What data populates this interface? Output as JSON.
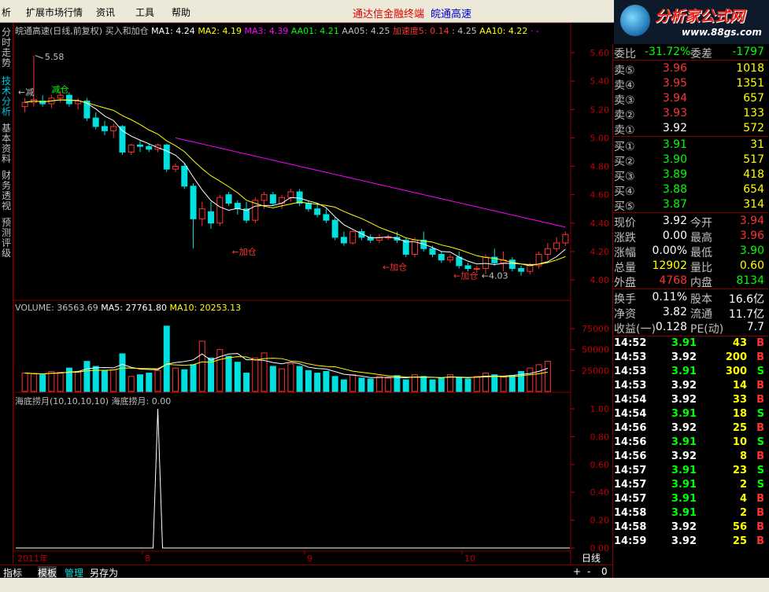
{
  "menu": {
    "items": [
      "析",
      "扩展市场行情",
      "资讯",
      "工具",
      "帮助"
    ],
    "brand_red": "通达信金融终端",
    "brand_blue": "皖通高速"
  },
  "logo": {
    "title": "分析家公式网",
    "url": "www.88gs.com"
  },
  "left_tabs": [
    "分时走势",
    "技术分析",
    "基本资料",
    "财务透视",
    "预测评级"
  ],
  "chart_header": {
    "title": "皖通高速(日线,前复权)",
    "formula": "买入和加仓",
    "ma1": "MA1: 4.24",
    "ma2": "MA2: 4.19",
    "ma3": "MA3: 4.39",
    "aa01": "AA01: 4.21",
    "aa05": "AA05: 4.25",
    "jsd": "加速度5: 0.14",
    "jsd2": ": 4.25",
    "aa10": "AA10: 4.22",
    "tail": "·  -"
  },
  "price_axis": [
    "5.60",
    "5.40",
    "5.20",
    "5.00",
    "4.80",
    "4.60",
    "4.40",
    "4.20",
    "4.00"
  ],
  "annotations": {
    "high": "5.58",
    "low": "4.03",
    "jc": "减仓",
    "add": [
      "←加仓",
      "←加仓",
      "←加仓"
    ],
    "jc2": "←减"
  },
  "volume_header": {
    "v": "VOLUME: 36563.69",
    "ma5": "MA5: 27761.80",
    "ma10": "MA10: 20253.13"
  },
  "volume_axis": [
    "75000",
    "50000",
    "25000"
  ],
  "ind_header": {
    "name": "海底捞月(10,10,10,10)",
    "val": "海底捞月: 0.00"
  },
  "ind_axis": [
    "1.00",
    "0.80",
    "0.60",
    "0.40",
    "0.20",
    "0.00"
  ],
  "time_axis": {
    "year": "2011年",
    "m8": "8",
    "m9": "9",
    "m10": "10",
    "period": "日线"
  },
  "bottom_tabs": [
    "指标",
    "模板",
    "管理",
    "另存为"
  ],
  "bottom_right": [
    "+",
    "-",
    "0"
  ],
  "quote": {
    "wb_label": "委比",
    "wb": "-31.72%",
    "wc_label": "委差",
    "wc": "-1797",
    "sell": [
      {
        "l": "卖⑤",
        "p": "3.96",
        "v": "1018"
      },
      {
        "l": "卖④",
        "p": "3.95",
        "v": "1351"
      },
      {
        "l": "卖③",
        "p": "3.94",
        "v": "657"
      },
      {
        "l": "卖②",
        "p": "3.93",
        "v": "133"
      },
      {
        "l": "卖①",
        "p": "3.92",
        "v": "572"
      }
    ],
    "buy": [
      {
        "l": "买①",
        "p": "3.91",
        "v": "31"
      },
      {
        "l": "买②",
        "p": "3.90",
        "v": "517"
      },
      {
        "l": "买③",
        "p": "3.89",
        "v": "418"
      },
      {
        "l": "买④",
        "p": "3.88",
        "v": "654"
      },
      {
        "l": "买⑤",
        "p": "3.87",
        "v": "314"
      }
    ],
    "stats": [
      {
        "a": "现价",
        "av": "3.92",
        "b": "今开",
        "bv": "3.94"
      },
      {
        "a": "涨跌",
        "av": "0.00",
        "b": "最高",
        "bv": "3.96"
      },
      {
        "a": "涨幅",
        "av": "0.00%",
        "b": "最低",
        "bv": "3.90"
      },
      {
        "a": "总量",
        "av": "12902",
        "b": "量比",
        "bv": "0.60"
      },
      {
        "a": "外盘",
        "av": "4768",
        "b": "内盘",
        "bv": "8134"
      }
    ],
    "stats2": [
      {
        "a": "换手",
        "av": "0.11%",
        "b": "股本",
        "bv": "16.6亿"
      },
      {
        "a": "净资",
        "av": "3.82",
        "b": "流通",
        "bv": "11.7亿"
      },
      {
        "a": "收益(一)",
        "av": "0.128",
        "b": "PE(动)",
        "bv": "7.7"
      }
    ],
    "ticks": [
      {
        "t": "14:52",
        "p": "3.91",
        "v": "43",
        "s": "B"
      },
      {
        "t": "14:53",
        "p": "3.92",
        "v": "200",
        "s": "B"
      },
      {
        "t": "14:53",
        "p": "3.91",
        "v": "300",
        "s": "S"
      },
      {
        "t": "14:53",
        "p": "3.92",
        "v": "14",
        "s": "B"
      },
      {
        "t": "14:54",
        "p": "3.92",
        "v": "33",
        "s": "B"
      },
      {
        "t": "14:54",
        "p": "3.91",
        "v": "18",
        "s": "S"
      },
      {
        "t": "14:56",
        "p": "3.92",
        "v": "25",
        "s": "B"
      },
      {
        "t": "14:56",
        "p": "3.91",
        "v": "10",
        "s": "S"
      },
      {
        "t": "14:56",
        "p": "3.92",
        "v": "8",
        "s": "B"
      },
      {
        "t": "14:57",
        "p": "3.91",
        "v": "23",
        "s": "S"
      },
      {
        "t": "14:57",
        "p": "3.91",
        "v": "2",
        "s": "S"
      },
      {
        "t": "14:57",
        "p": "3.91",
        "v": "4",
        "s": "B"
      },
      {
        "t": "14:58",
        "p": "3.91",
        "v": "2",
        "s": "B"
      },
      {
        "t": "14:58",
        "p": "3.92",
        "v": "56",
        "s": "B"
      },
      {
        "t": "14:59",
        "p": "3.92",
        "v": "25",
        "s": "B"
      }
    ]
  },
  "colors": {
    "up": "#ff3232",
    "down": "#00e0e0",
    "ma1": "#ffffff",
    "ma2": "#ffff00",
    "ma3": "#ff00ff",
    "aa": "#00ff00",
    "grid": "#800000",
    "axis_red": "#c00000"
  },
  "chart_data": {
    "type": "candlestick",
    "ylim_price": [
      4.0,
      5.6
    ],
    "candles": [
      {
        "o": 5.22,
        "h": 5.28,
        "l": 5.18,
        "c": 5.25
      },
      {
        "o": 5.25,
        "h": 5.58,
        "l": 5.22,
        "c": 5.27
      },
      {
        "o": 5.26,
        "h": 5.3,
        "l": 5.22,
        "c": 5.24
      },
      {
        "o": 5.24,
        "h": 5.3,
        "l": 5.21,
        "c": 5.28
      },
      {
        "o": 5.28,
        "h": 5.33,
        "l": 5.25,
        "c": 5.3
      },
      {
        "o": 5.3,
        "h": 5.32,
        "l": 5.22,
        "c": 5.24
      },
      {
        "o": 5.24,
        "h": 5.28,
        "l": 5.2,
        "c": 5.26
      },
      {
        "o": 5.26,
        "h": 5.28,
        "l": 5.12,
        "c": 5.14
      },
      {
        "o": 5.14,
        "h": 5.18,
        "l": 5.06,
        "c": 5.08
      },
      {
        "o": 5.08,
        "h": 5.12,
        "l": 5.02,
        "c": 5.05
      },
      {
        "o": 5.05,
        "h": 5.1,
        "l": 5.0,
        "c": 5.08
      },
      {
        "o": 5.08,
        "h": 5.09,
        "l": 4.88,
        "c": 4.9
      },
      {
        "o": 4.9,
        "h": 4.96,
        "l": 4.88,
        "c": 4.95
      },
      {
        "o": 4.95,
        "h": 4.98,
        "l": 4.9,
        "c": 4.94
      },
      {
        "o": 4.94,
        "h": 4.96,
        "l": 4.9,
        "c": 4.92
      },
      {
        "o": 4.92,
        "h": 4.96,
        "l": 4.9,
        "c": 4.95
      },
      {
        "o": 4.95,
        "h": 4.96,
        "l": 4.76,
        "c": 4.78
      },
      {
        "o": 4.78,
        "h": 4.82,
        "l": 4.76,
        "c": 4.8
      },
      {
        "o": 4.8,
        "h": 4.82,
        "l": 4.64,
        "c": 4.66
      },
      {
        "o": 4.66,
        "h": 4.68,
        "l": 4.22,
        "c": 4.43
      },
      {
        "o": 4.43,
        "h": 4.55,
        "l": 4.38,
        "c": 4.5
      },
      {
        "o": 4.48,
        "h": 4.55,
        "l": 4.36,
        "c": 4.4
      },
      {
        "o": 4.4,
        "h": 4.6,
        "l": 4.38,
        "c": 4.58
      },
      {
        "o": 4.6,
        "h": 4.62,
        "l": 4.52,
        "c": 4.54
      },
      {
        "o": 4.54,
        "h": 4.56,
        "l": 4.46,
        "c": 4.5
      },
      {
        "o": 4.5,
        "h": 4.55,
        "l": 4.4,
        "c": 4.42
      },
      {
        "o": 4.42,
        "h": 4.58,
        "l": 4.4,
        "c": 4.56
      },
      {
        "o": 4.56,
        "h": 4.62,
        "l": 4.5,
        "c": 4.6
      },
      {
        "o": 4.6,
        "h": 4.62,
        "l": 4.52,
        "c": 4.54
      },
      {
        "o": 4.54,
        "h": 4.6,
        "l": 4.5,
        "c": 4.58
      },
      {
        "o": 4.58,
        "h": 4.64,
        "l": 4.55,
        "c": 4.62
      },
      {
        "o": 4.62,
        "h": 4.64,
        "l": 4.52,
        "c": 4.54
      },
      {
        "o": 4.54,
        "h": 4.56,
        "l": 4.48,
        "c": 4.5
      },
      {
        "o": 4.5,
        "h": 4.54,
        "l": 4.44,
        "c": 4.46
      },
      {
        "o": 4.46,
        "h": 4.5,
        "l": 4.4,
        "c": 4.42
      },
      {
        "o": 4.42,
        "h": 4.44,
        "l": 4.28,
        "c": 4.3
      },
      {
        "o": 4.3,
        "h": 4.34,
        "l": 4.24,
        "c": 4.26
      },
      {
        "o": 4.26,
        "h": 4.35,
        "l": 4.25,
        "c": 4.34
      },
      {
        "o": 4.34,
        "h": 4.36,
        "l": 4.28,
        "c": 4.3
      },
      {
        "o": 4.3,
        "h": 4.32,
        "l": 4.26,
        "c": 4.28
      },
      {
        "o": 4.28,
        "h": 4.32,
        "l": 4.26,
        "c": 4.3
      },
      {
        "o": 4.3,
        "h": 4.32,
        "l": 4.28,
        "c": 4.3
      },
      {
        "o": 4.3,
        "h": 4.34,
        "l": 4.26,
        "c": 4.28
      },
      {
        "o": 4.28,
        "h": 4.3,
        "l": 4.16,
        "c": 4.18
      },
      {
        "o": 4.18,
        "h": 4.3,
        "l": 4.16,
        "c": 4.28
      },
      {
        "o": 4.28,
        "h": 4.34,
        "l": 4.2,
        "c": 4.22
      },
      {
        "o": 4.22,
        "h": 4.24,
        "l": 4.16,
        "c": 4.18
      },
      {
        "o": 4.18,
        "h": 4.2,
        "l": 4.12,
        "c": 4.14
      },
      {
        "o": 4.14,
        "h": 4.18,
        "l": 4.12,
        "c": 4.16
      },
      {
        "o": 4.16,
        "h": 4.2,
        "l": 4.08,
        "c": 4.1
      },
      {
        "o": 4.1,
        "h": 4.12,
        "l": 4.06,
        "c": 4.08
      },
      {
        "o": 4.08,
        "h": 4.1,
        "l": 4.05,
        "c": 4.08
      },
      {
        "o": 4.08,
        "h": 4.18,
        "l": 4.04,
        "c": 4.16
      },
      {
        "o": 4.16,
        "h": 4.22,
        "l": 4.1,
        "c": 4.12
      },
      {
        "o": 4.12,
        "h": 4.2,
        "l": 4.06,
        "c": 4.14
      },
      {
        "o": 4.14,
        "h": 4.16,
        "l": 4.06,
        "c": 4.08
      },
      {
        "o": 4.08,
        "h": 4.1,
        "l": 4.03,
        "c": 4.06
      },
      {
        "o": 4.06,
        "h": 4.12,
        "l": 4.04,
        "c": 4.1
      },
      {
        "o": 4.1,
        "h": 4.2,
        "l": 4.08,
        "c": 4.18
      },
      {
        "o": 4.18,
        "h": 4.26,
        "l": 4.14,
        "c": 4.22
      },
      {
        "o": 4.22,
        "h": 4.3,
        "l": 4.2,
        "c": 4.26
      },
      {
        "o": 4.26,
        "h": 4.34,
        "l": 4.24,
        "c": 4.32
      }
    ],
    "volume": [
      22000,
      21000,
      20000,
      24000,
      23000,
      28000,
      24000,
      36000,
      30000,
      25000,
      26000,
      45000,
      18000,
      20000,
      22000,
      25000,
      78000,
      28000,
      26000,
      32000,
      60000,
      40000,
      50000,
      42000,
      35000,
      22000,
      40000,
      46000,
      30000,
      27000,
      33000,
      30000,
      25000,
      22000,
      24000,
      18000,
      14000,
      20000,
      16000,
      15000,
      18000,
      16000,
      19000,
      14000,
      20000,
      18000,
      14000,
      16000,
      20000,
      17000,
      15000,
      18000,
      22000,
      20000,
      17000,
      19000,
      24000,
      28000,
      32000,
      36000
    ],
    "ind": {
      "spike_index": 15,
      "ylim": [
        0,
        1
      ]
    }
  }
}
